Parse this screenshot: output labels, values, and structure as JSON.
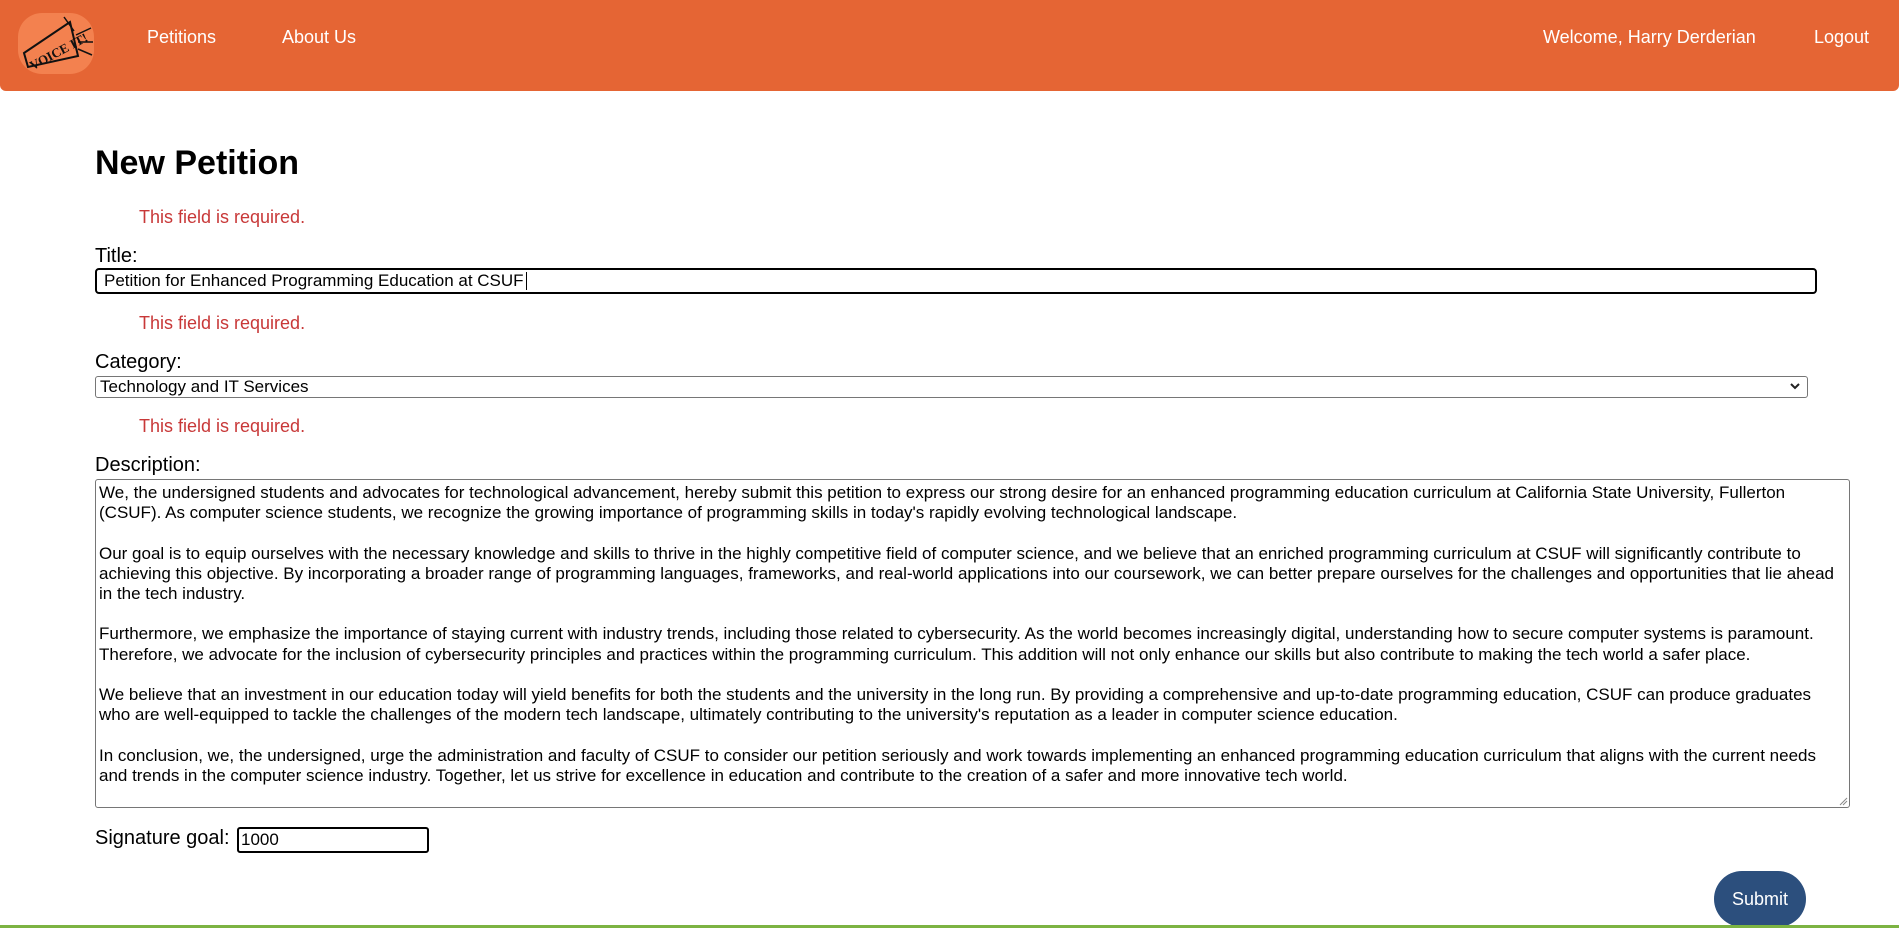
{
  "navbar": {
    "logo_text": "VOICE IT!",
    "links": [
      "Petitions",
      "About Us"
    ],
    "welcome": "Welcome, Harry Derderian",
    "logout": "Logout"
  },
  "form": {
    "heading": "New Petition",
    "required_message": "This field is required.",
    "title_label": "Title:",
    "title_value": "Petition for Enhanced Programming Education at CSUF",
    "category_label": "Category:",
    "category_value": "Technology and IT Services",
    "description_label": "Description:",
    "description_paragraphs": [
      "We, the undersigned students and advocates for technological advancement, hereby submit this petition to express our strong desire for an enhanced programming education curriculum at California State University, Fullerton (CSUF). As computer science students, we recognize the growing importance of programming skills in today's rapidly evolving technological landscape.",
      "Our goal is to equip ourselves with the necessary knowledge and skills to thrive in the highly competitive field of computer science, and we believe that an enriched programming curriculum at CSUF will significantly contribute to achieving this objective. By incorporating a broader range of programming languages, frameworks, and real-world applications into our coursework, we can better prepare ourselves for the challenges and opportunities that lie ahead in the tech industry.",
      "Furthermore, we emphasize the importance of staying current with industry trends, including those related to cybersecurity. As the world becomes increasingly digital, understanding how to secure computer systems is paramount. Therefore, we advocate for the inclusion of cybersecurity principles and practices within the programming curriculum. This addition will not only enhance our skills but also contribute to making the tech world a safer place.",
      "We believe that an investment in our education today will yield benefits for both the students and the university in the long run. By providing a comprehensive and up-to-date programming education, CSUF can produce graduates who are well-equipped to tackle the challenges of the modern tech landscape, ultimately contributing to the university's reputation as a leader in computer science education.",
      "In conclusion, we, the undersigned, urge the administration and faculty of CSUF to consider our petition seriously and work towards implementing an enhanced programming education curriculum that aligns with the current needs and trends in the computer science industry. Together, let us strive for excellence in education and contribute to the creation of a safer and more innovative tech world."
    ],
    "goal_label": "Signature goal:",
    "goal_value": "1000",
    "submit_label": "Submit"
  },
  "colors": {
    "navbar": "#e56534",
    "logo_bg": "#f3814f",
    "error": "#c83838",
    "submit": "#2c4f7d",
    "bottom_strip": "#7cb342"
  },
  "icons": {
    "logo": "megaphone-logo-icon",
    "select_arrow": "chevron-down-icon",
    "resize": "resize-grip-icon"
  }
}
